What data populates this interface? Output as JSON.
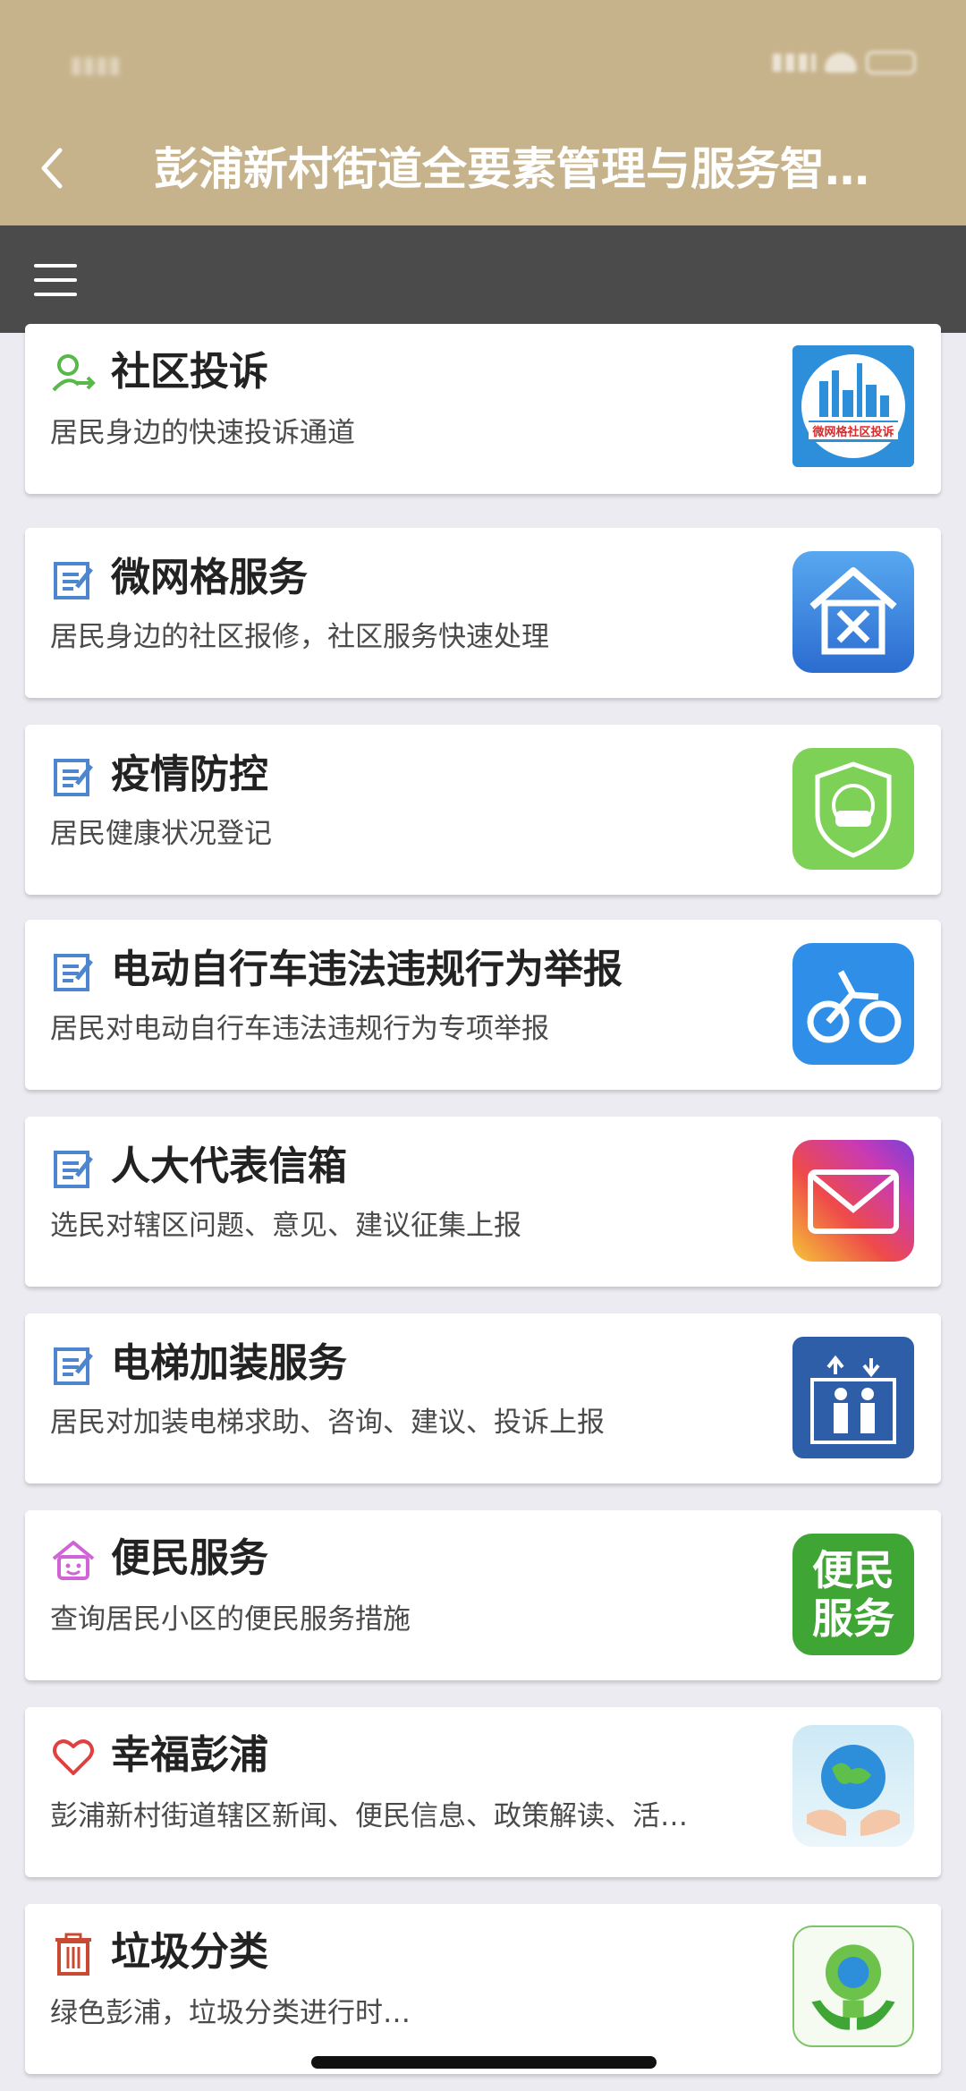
{
  "header": {
    "title": "彭浦新村街道全要素管理与服务智…",
    "status_time": ""
  },
  "colors": {
    "header_bg": "#C7B38B",
    "toolbar_bg": "#4B4B4B",
    "page_bg": "#ECEBF1"
  },
  "items": [
    {
      "title": "社区投诉",
      "desc": "居民身边的快速投诉通道",
      "icon": "person-arrow-icon",
      "thumb": "city-complaint-thumb",
      "thumb_label": "微网格社区投诉"
    },
    {
      "title": "微网格服务",
      "desc": "居民身边的社区报修，社区服务快速处理",
      "icon": "edit-note-icon",
      "thumb": "house-tools-thumb"
    },
    {
      "title": "疫情防控",
      "desc": "居民健康状况登记",
      "icon": "edit-note-icon",
      "thumb": "mask-shield-thumb"
    },
    {
      "title": "电动自行车违法违规行为举报",
      "desc": "居民对电动自行车违法违规行为专项举报",
      "icon": "edit-note-icon",
      "thumb": "bicycle-thumb"
    },
    {
      "title": "人大代表信箱",
      "desc": "选民对辖区问题、意见、建议征集上报",
      "icon": "edit-note-icon",
      "thumb": "mail-thumb"
    },
    {
      "title": "电梯加装服务",
      "desc": "居民对加装电梯求助、咨询、建议、投诉上报",
      "icon": "edit-note-icon",
      "thumb": "elevator-thumb"
    },
    {
      "title": "便民服务",
      "desc": "查询居民小区的便民服务措施",
      "icon": "smile-house-icon",
      "thumb": "convenience-thumb",
      "thumb_label_1": "便民",
      "thumb_label_2": "服务"
    },
    {
      "title": "幸福彭浦",
      "desc": "彭浦新村街道辖区新闻、便民信息、政策解读、活…",
      "icon": "heart-icon",
      "thumb": "earth-hands-thumb"
    },
    {
      "title": "垃圾分类",
      "desc": "绿色彭浦，垃圾分类进行时…",
      "icon": "trash-icon",
      "thumb": "green-bulb-thumb"
    }
  ]
}
